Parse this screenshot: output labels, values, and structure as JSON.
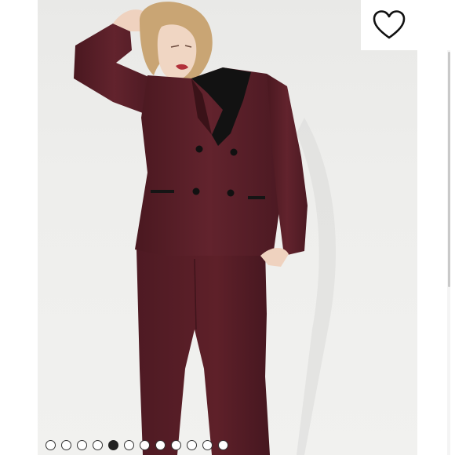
{
  "gallery": {
    "image_description": "",
    "total_slides": 12,
    "active_slide": 5
  },
  "colors": {
    "suit": "#5a1f28",
    "lapel": "#111111",
    "background": "#ededeb",
    "dot_active": "#222222"
  },
  "icons": {
    "favorite": "heart-outline-icon"
  }
}
